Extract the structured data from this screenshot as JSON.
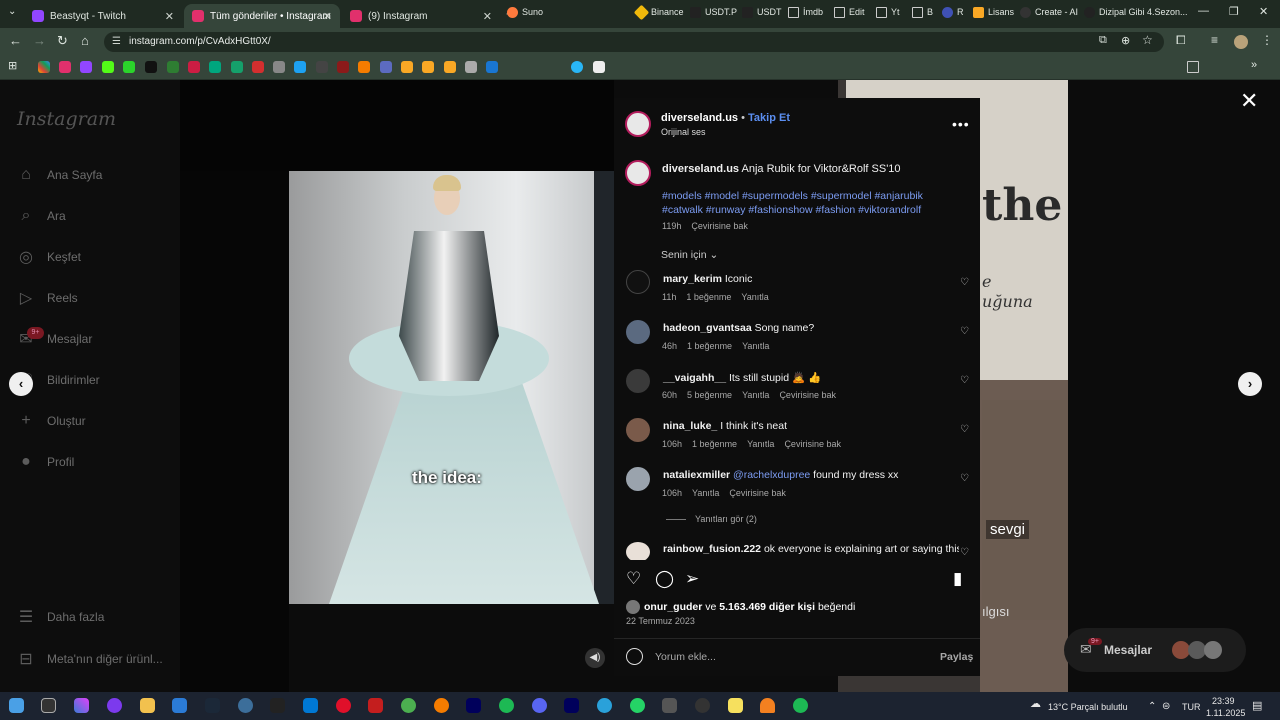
{
  "browser": {
    "tabs": [
      {
        "label": "Beastyqt - Twitch",
        "color": "#9146ff"
      },
      {
        "label": "Tüm gönderiler • Instagram",
        "color": "#e1306c"
      },
      {
        "label": "(9) Instagram",
        "color": "#e1306c"
      }
    ],
    "new_tab": "+",
    "url": "instagram.com/p/CvAdxHGtt0X/",
    "bookmarks": [
      "Suno",
      "Binance",
      "USDT.P",
      "USDT",
      "İmdb",
      "Edit",
      "Yt",
      "B",
      "R",
      "Lisans",
      "Create - AI",
      "Dizipal Gibi 4.Sezon..."
    ],
    "window_controls": [
      "—",
      "❐",
      "✕"
    ]
  },
  "instagram": {
    "logo": "Instagram",
    "nav": [
      {
        "label": "Ana Sayfa",
        "icon": "⌂"
      },
      {
        "label": "Ara",
        "icon": "⌕"
      },
      {
        "label": "Keşfet",
        "icon": "◎"
      },
      {
        "label": "Reels",
        "icon": "▷"
      },
      {
        "label": "Mesajlar",
        "icon": "✉"
      },
      {
        "label": "Bildirimler",
        "icon": "♡"
      },
      {
        "label": "Oluştur",
        "icon": "+"
      },
      {
        "label": "Profil",
        "icon": "●"
      }
    ],
    "messages_badge": "9+",
    "more": "Daha fazla",
    "meta_products": "Meta'nın diğer ürünl...",
    "background_post": {
      "big_text": "the",
      "small_text1": "e",
      "small_text2": "uğuna",
      "lower_text": "sevgi",
      "lower_text2": "ılgısı"
    }
  },
  "post": {
    "video_caption": "the idea:",
    "author": "diverseland.us",
    "follow": "Takip Et",
    "audio": "Orijinal ses",
    "caption": "Anja Rubik for Viktor&Rolf SS'10",
    "hashtags_line1": "#models #model #supermodels #supermodel #anjarubik",
    "hashtags_line2": "#catwalk #runway #fashionshow #fashion #viktorandrolf",
    "caption_time": "119h",
    "see_translation": "Çevirisine bak",
    "for_you": "Senin için",
    "comments": [
      {
        "user": "mary_kerim",
        "text": "Iconic",
        "time": "11h",
        "likes": "1 beğenme",
        "reply": "Yanıtla",
        "translate": ""
      },
      {
        "user": "hadeon_gvantsaa",
        "text": "Song name?",
        "time": "46h",
        "likes": "1 beğenme",
        "reply": "Yanıtla",
        "translate": ""
      },
      {
        "user": "__vaigahh__",
        "text": "Its still stupid 🙇 👍",
        "time": "60h",
        "likes": "5 beğenme",
        "reply": "Yanıtla",
        "translate": "Çevirisine bak"
      },
      {
        "user": "nina_luke_",
        "text": "I think it's neat",
        "time": "106h",
        "likes": "1 beğenme",
        "reply": "Yanıtla",
        "translate": "Çevirisine bak"
      },
      {
        "user": "nataliexmiller",
        "mention": "@rachelxdupree",
        "text": "found my dress xx",
        "time": "106h",
        "likes": "",
        "reply": "Yanıtla",
        "translate": "Çevirisine bak"
      },
      {
        "user": "rainbow_fusion.222",
        "text": "ok everyone is explaining art or saying this"
      }
    ],
    "view_replies": "Yanıtları gör (2)",
    "liked_by_user": "onur_guder",
    "liked_by_connector": "ve",
    "liked_by_count": "5.163.469 diğer kişi",
    "liked_by_suffix": "beğendi",
    "date": "22 Temmuz 2023",
    "comment_placeholder": "Yorum ekle...",
    "share": "Paylaş",
    "floating_messages": "Mesajlar",
    "floating_badge": "9+"
  },
  "taskbar": {
    "weather": "13°C  Parçalı bulutlu",
    "lang": "TUR",
    "time": "23:39",
    "date": "1.11.2025"
  }
}
